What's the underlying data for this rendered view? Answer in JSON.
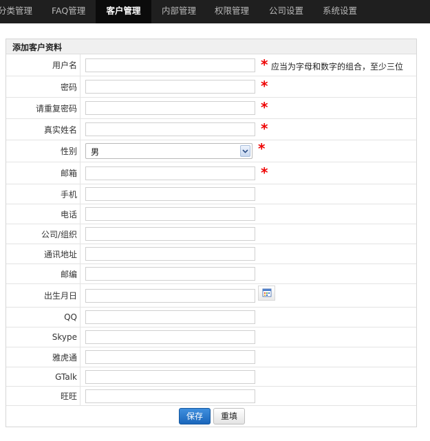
{
  "nav": {
    "tabs": [
      {
        "label": "分类管理",
        "active": false
      },
      {
        "label": "FAQ管理",
        "active": false
      },
      {
        "label": "客户管理",
        "active": true
      },
      {
        "label": "内部管理",
        "active": false
      },
      {
        "label": "权限管理",
        "active": false
      },
      {
        "label": "公司设置",
        "active": false
      },
      {
        "label": "系统设置",
        "active": false
      }
    ]
  },
  "form": {
    "title": "添加客户资料",
    "required_mark": "*",
    "fields": {
      "username": {
        "label": "用户名",
        "value": "",
        "hint": "应当为字母和数字的组合，至少三位"
      },
      "password": {
        "label": "密码",
        "value": ""
      },
      "password_confirm": {
        "label": "请重复密码",
        "value": ""
      },
      "realname": {
        "label": "真实姓名",
        "value": ""
      },
      "gender": {
        "label": "性别",
        "selected": "男"
      },
      "email": {
        "label": "邮箱",
        "value": ""
      },
      "mobile": {
        "label": "手机",
        "value": ""
      },
      "phone": {
        "label": "电话",
        "value": ""
      },
      "company": {
        "label": "公司/组织",
        "value": ""
      },
      "address": {
        "label": "通讯地址",
        "value": ""
      },
      "postcode": {
        "label": "邮编",
        "value": ""
      },
      "birthday": {
        "label": "出生月日",
        "value": ""
      },
      "qq": {
        "label": "QQ",
        "value": ""
      },
      "skype": {
        "label": "Skype",
        "value": ""
      },
      "yahoo": {
        "label": "雅虎通",
        "value": ""
      },
      "gtalk": {
        "label": "GTalk",
        "value": ""
      },
      "wangwang": {
        "label": "旺旺",
        "value": ""
      }
    },
    "buttons": {
      "save": "保存",
      "reset": "重填"
    }
  },
  "colors": {
    "nav_bg": "#1f1f1f",
    "nav_active_bg": "#0b0b0b",
    "required": "#ee0000",
    "primary_button": "#1a66bb"
  },
  "icons": {
    "gender_dropdown": "chevron-down-icon",
    "birthday_picker": "calendar-icon"
  }
}
